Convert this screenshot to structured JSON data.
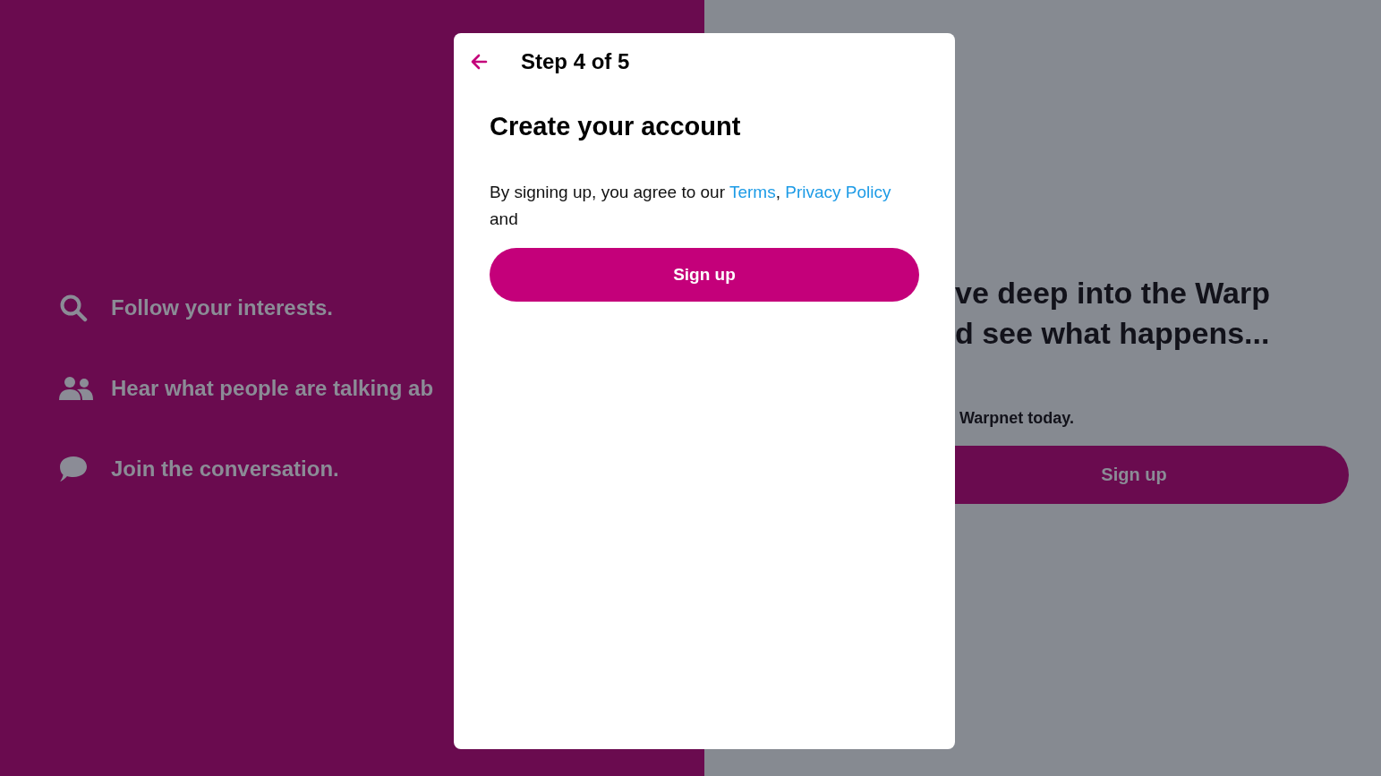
{
  "features": [
    {
      "kind": "search",
      "text": "Follow your interests."
    },
    {
      "kind": "people",
      "text": "Hear what people are talking ab"
    },
    {
      "kind": "chat",
      "text": "Join the conversation."
    }
  ],
  "hero": {
    "heading_lines": [
      "ve deep into the Warp",
      "d see what happens..."
    ],
    "subtitle": "Warpnet today.",
    "button": "Sign up"
  },
  "modal": {
    "step": "Step 4 of 5",
    "title": "Create your account",
    "agreement": {
      "lead": "By signing up, you agree to our ",
      "links": [
        {
          "text": "Terms",
          "separator": ", "
        },
        {
          "text": "Privacy Policy"
        }
      ],
      "tail": " and"
    },
    "button": "Sign up"
  }
}
